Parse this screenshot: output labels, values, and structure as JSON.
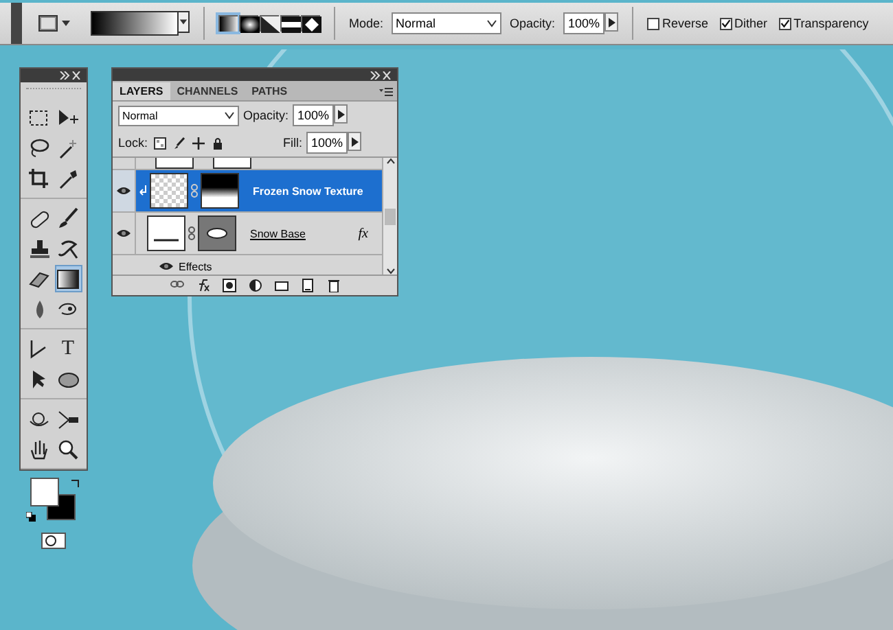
{
  "options_bar": {
    "gradient_types": [
      {
        "kind": "linear",
        "selected": true
      },
      {
        "kind": "radial",
        "selected": false
      },
      {
        "kind": "angle",
        "selected": false
      },
      {
        "kind": "reflected",
        "selected": false
      },
      {
        "kind": "diamond",
        "selected": false
      }
    ],
    "mode_label": "Mode:",
    "mode": "Normal",
    "opacity_label": "Opacity:",
    "opacity": "100%",
    "checkboxes": [
      {
        "label": "Reverse",
        "checked": false
      },
      {
        "label": "Dither",
        "checked": true
      },
      {
        "label": "Transparency",
        "checked": true
      }
    ]
  },
  "toolbox": {
    "groups": [
      [
        {
          "kind": "marquee",
          "selected": false
        },
        {
          "kind": "move",
          "selected": false
        },
        {
          "kind": "lasso",
          "selected": false
        },
        {
          "kind": "wand",
          "selected": false
        },
        {
          "kind": "crop",
          "selected": false
        },
        {
          "kind": "eyedropper",
          "selected": false
        }
      ],
      [
        {
          "kind": "bandage",
          "selected": false
        },
        {
          "kind": "brush",
          "selected": false
        },
        {
          "kind": "stamp",
          "selected": false
        },
        {
          "kind": "history",
          "selected": false
        },
        {
          "kind": "eraser",
          "selected": false
        },
        {
          "kind": "gradient",
          "selected": true
        },
        {
          "kind": "drop",
          "selected": false
        },
        {
          "kind": "smudge",
          "selected": false
        }
      ],
      [
        {
          "kind": "pen",
          "selected": false
        },
        {
          "kind": "text",
          "selected": false,
          "glyph": "T"
        },
        {
          "kind": "pointer",
          "selected": false
        },
        {
          "kind": "ellipse",
          "selected": false
        }
      ],
      [
        {
          "kind": "rotate3d",
          "selected": false
        },
        {
          "kind": "camera3d",
          "selected": false
        },
        {
          "kind": "hand",
          "selected": false
        },
        {
          "kind": "zoom",
          "selected": false
        }
      ]
    ]
  },
  "layers_panel": {
    "tabs": [
      {
        "label": "LAYERS",
        "selected": true
      },
      {
        "label": "CHANNELS",
        "selected": false
      },
      {
        "label": "PATHS",
        "selected": false
      }
    ],
    "blend_mode": "Normal",
    "opacity_label": "Opacity:",
    "opacity": "100%",
    "lock_label": "Lock:",
    "fill_label": "Fill:",
    "fill": "100%",
    "layers": [
      {
        "kind": "partial"
      },
      {
        "kind": "layer",
        "name": "Frozen Snow Texture",
        "visible": true,
        "selected": true,
        "fx": false
      },
      {
        "kind": "layer",
        "name": "Snow Base",
        "visible": true,
        "selected": false,
        "fx": true,
        "fx_label": "fx"
      },
      {
        "kind": "effects",
        "name": "Effects",
        "visible": true
      }
    ]
  }
}
